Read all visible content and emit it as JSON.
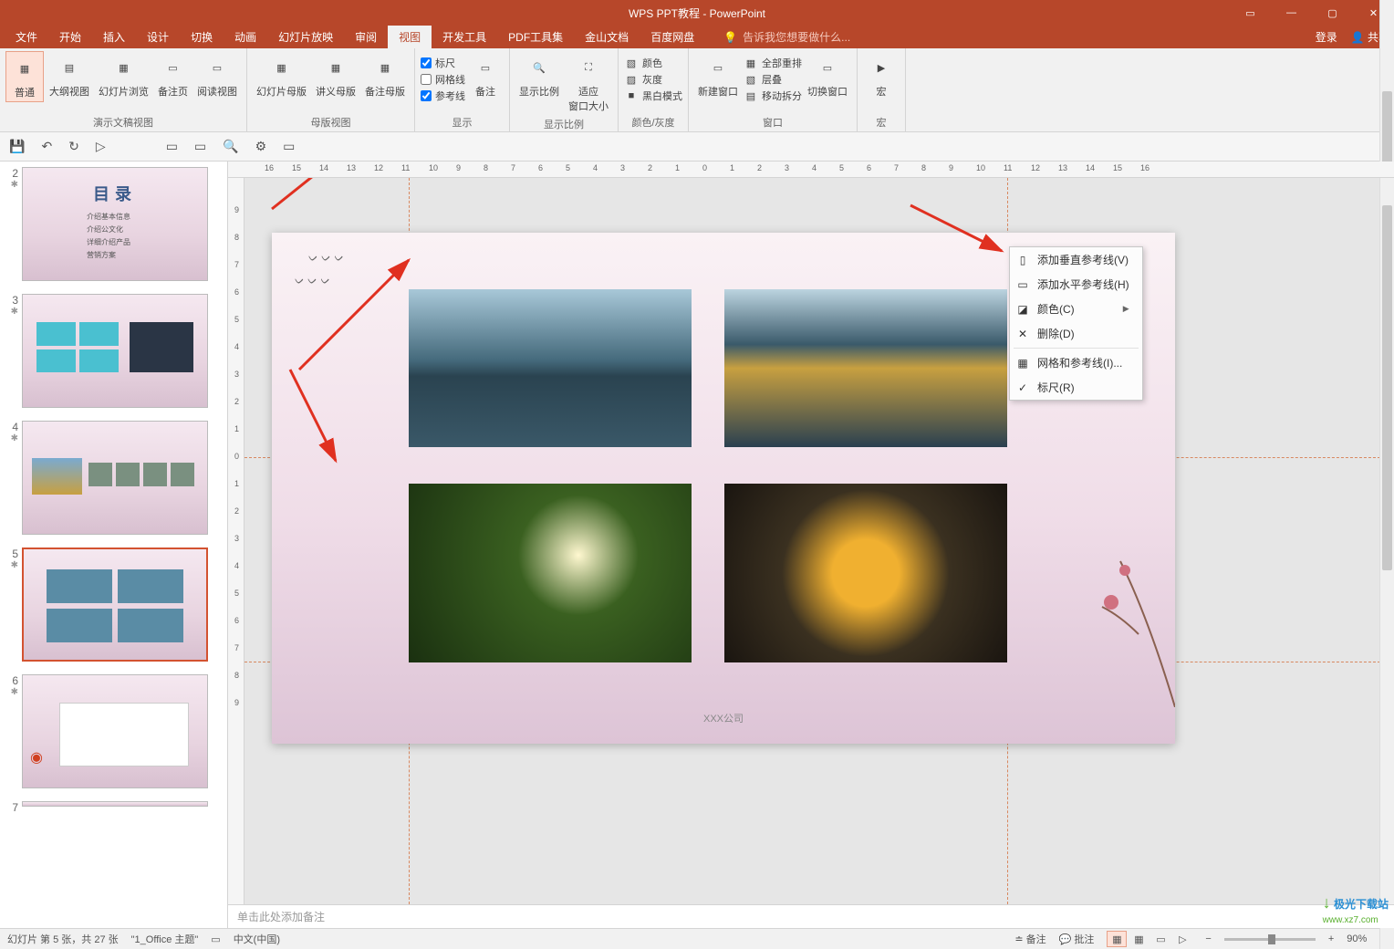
{
  "titlebar": {
    "title": "WPS PPT教程 - PowerPoint"
  },
  "menubar": {
    "tabs": [
      "文件",
      "开始",
      "插入",
      "设计",
      "切换",
      "动画",
      "幻灯片放映",
      "审阅",
      "视图",
      "开发工具",
      "PDF工具集",
      "金山文档",
      "百度网盘"
    ],
    "active_index": 8,
    "tell_me": "告诉我您想要做什么...",
    "login": "登录",
    "share": "共享"
  },
  "ribbon": {
    "groups": {
      "presentation_views": {
        "label": "演示文稿视图",
        "normal": "普通",
        "outline": "大纲视图",
        "sorter": "幻灯片浏览",
        "notes_page": "备注页",
        "reading": "阅读视图"
      },
      "master_views": {
        "label": "母版视图",
        "slide_master": "幻灯片母版",
        "handout_master": "讲义母版",
        "notes_master": "备注母版"
      },
      "show": {
        "label": "显示",
        "ruler": "标尺",
        "gridlines": "网格线",
        "guides": "参考线",
        "notes": "备注"
      },
      "zoom": {
        "label": "显示比例",
        "zoom": "显示比例",
        "fit": "适应",
        "fit2": "窗口大小"
      },
      "color": {
        "label": "颜色/灰度",
        "color": "颜色",
        "gray": "灰度",
        "bw": "黑白模式"
      },
      "window": {
        "label": "窗口",
        "new_window": "新建窗口",
        "arrange_all": "全部重排",
        "cascade": "层叠",
        "move_split": "移动拆分",
        "switch": "切换窗口"
      },
      "macros": {
        "label": "宏",
        "macros": "宏"
      }
    }
  },
  "slides": {
    "items": [
      {
        "num": "2",
        "title": "目录",
        "toc": [
          "介绍基本信息",
          "介绍公文化",
          "详细介绍产品",
          "营销方案"
        ]
      },
      {
        "num": "3"
      },
      {
        "num": "4"
      },
      {
        "num": "5"
      },
      {
        "num": "6"
      },
      {
        "num": "7"
      }
    ],
    "selected_index": 3
  },
  "canvas": {
    "company": "XXX公司"
  },
  "ruler": {
    "h": [
      "16",
      "15",
      "14",
      "13",
      "12",
      "11",
      "10",
      "9",
      "8",
      "7",
      "6",
      "5",
      "4",
      "3",
      "2",
      "1",
      "0",
      "1",
      "2",
      "3",
      "4",
      "5",
      "6",
      "7",
      "8",
      "9",
      "10",
      "11",
      "12",
      "13",
      "14",
      "15",
      "16"
    ],
    "v": [
      "9",
      "8",
      "7",
      "6",
      "5",
      "4",
      "3",
      "2",
      "1",
      "0",
      "1",
      "2",
      "3",
      "4",
      "5",
      "6",
      "7",
      "8",
      "9"
    ]
  },
  "context_menu": {
    "add_v_guide": "添加垂直参考线(V)",
    "add_h_guide": "添加水平参考线(H)",
    "color": "颜色(C)",
    "delete": "删除(D)",
    "grid_guides": "网格和参考线(I)...",
    "ruler": "标尺(R)"
  },
  "notes": {
    "placeholder": "单击此处添加备注"
  },
  "statusbar": {
    "slide_info": "幻灯片 第 5 张，共 27 张",
    "theme": "\"1_Office 主题\"",
    "language": "中文(中国)",
    "notes_btn": "备注",
    "comments_btn": "批注",
    "zoom_pct": "90%"
  },
  "watermark": {
    "l1": "极光下载站",
    "l2": "www.xz7.com"
  }
}
